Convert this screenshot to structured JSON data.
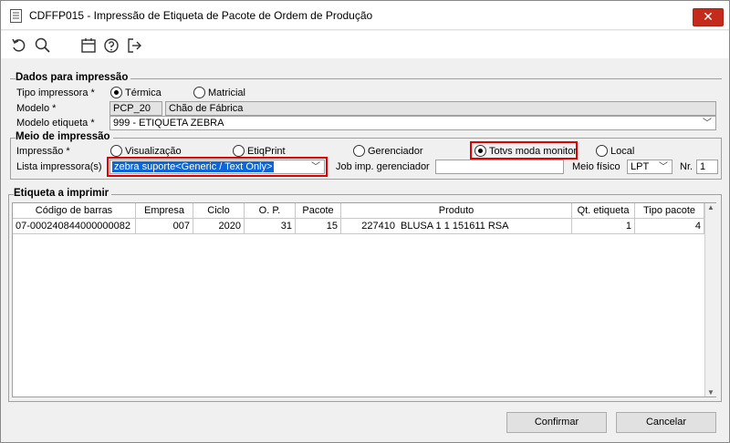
{
  "window": {
    "title": "CDFFP015 - Impressão de Etiqueta de Pacote de Ordem de Produção",
    "close_glyph": "✕"
  },
  "toolbar": {
    "icons": [
      "undo-icon",
      "search-icon",
      "calendar-icon",
      "help-icon",
      "exit-icon"
    ]
  },
  "dados": {
    "section_title": "Dados para impressão",
    "tipo_label": "Tipo impressora *",
    "tipo_options": [
      "Térmica",
      "Matricial"
    ],
    "tipo_selected": "Térmica",
    "modelo_label": "Modelo *",
    "modelo_code": "PCP_20",
    "modelo_desc": "Chão de Fábrica",
    "modelo_etiqueta_label": "Modelo etiqueta *",
    "modelo_etiqueta_value": "999 - ETIQUETA ZEBRA"
  },
  "meio": {
    "section_title": "Meio de impressão",
    "impressao_label": "Impressão *",
    "options": [
      "Visualização",
      "EtiqPrint",
      "Gerenciador",
      "Totvs moda monitor",
      "Local"
    ],
    "selected": "Totvs moda monitor",
    "lista_label": "Lista impressora(s)",
    "lista_value": "zebra suporte<Generic / Text Only>",
    "job_label": "Job imp. gerenciador",
    "job_value": "",
    "meio_fisico_label": "Meio físico",
    "meio_fisico_value": "LPT",
    "nr_label": "Nr.",
    "nr_value": "1"
  },
  "etiqueta": {
    "section_title": "Etiqueta a imprimir",
    "columns": [
      "Código de barras",
      "Empresa",
      "Ciclo",
      "O. P.",
      "Pacote",
      "Produto",
      "Qt. etiqueta",
      "Tipo pacote"
    ],
    "rows": [
      {
        "codigo": "07-000240844000000082",
        "empresa": "007",
        "ciclo": "2020",
        "op": "31",
        "pacote": "15",
        "produto_code": "227410",
        "produto_desc": "BLUSA 1 1 151611 RSA",
        "qt": "1",
        "tipo": "4"
      }
    ]
  },
  "buttons": {
    "confirmar": "Confirmar",
    "cancelar": "Cancelar"
  }
}
